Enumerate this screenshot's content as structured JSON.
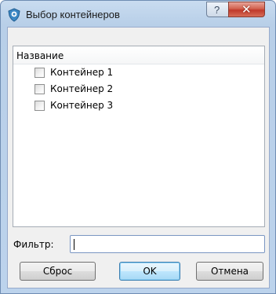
{
  "window": {
    "title": "Выбор контейнеров",
    "help_glyph": "?",
    "close_glyph": "✕"
  },
  "list": {
    "column_header": "Название",
    "items": [
      {
        "label": "Контейнер 1",
        "checked": false
      },
      {
        "label": "Контейнер 2",
        "checked": false
      },
      {
        "label": "Контейнер 3",
        "checked": false
      }
    ]
  },
  "filter": {
    "label": "Фильтр:",
    "value": ""
  },
  "buttons": {
    "reset": "Сброс",
    "ok": "OK",
    "cancel": "Отмена"
  }
}
